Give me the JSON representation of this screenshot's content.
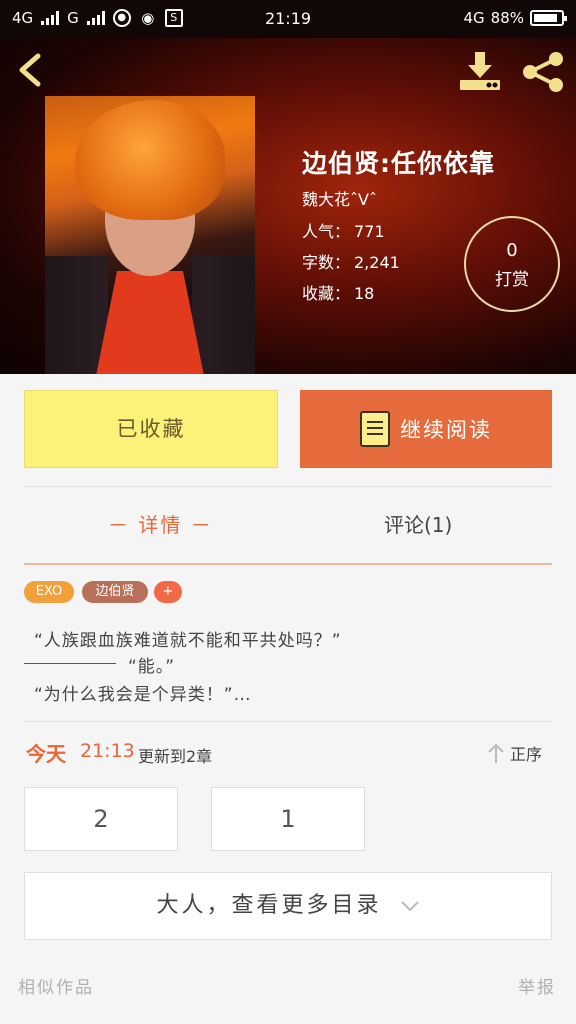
{
  "status_bar": {
    "net1": "4G",
    "net2": "G",
    "time": "21:19",
    "net3": "4G",
    "battery_percent": "88%",
    "battery_level": 0.88,
    "icons": [
      "signal-icon",
      "signal-icon",
      "camera-app-icon",
      "weibo-icon",
      "s-app-icon",
      "battery-icon"
    ]
  },
  "header": {
    "title": "边伯贤:任你依靠",
    "author": "魏大花ˆVˆ",
    "stats": [
      {
        "label": "人气：",
        "value": "771"
      },
      {
        "label": "字数：",
        "value": "2,241"
      },
      {
        "label": "收藏：",
        "value": "18"
      }
    ],
    "tip_count": "0",
    "tip_label": "打赏",
    "icons": {
      "back": "back-arrow-icon",
      "download": "download-icon",
      "share": "share-icon"
    }
  },
  "actions": {
    "collected_label": "已收藏",
    "read_label": "继续阅读"
  },
  "tabs": {
    "details": "－ 详情 －",
    "comments": "评论(1)"
  },
  "tags": [
    "EXO",
    "边伯贤",
    "+"
  ],
  "description": {
    "line1": "“人族跟血族难道就不能和平共处吗？”",
    "line2": "“能。”",
    "line3": "“为什么我会是个异类！”…"
  },
  "update": {
    "day": "今天",
    "time": "21:13",
    "text": "更新到2章",
    "sort_label": "正序"
  },
  "chapters": [
    "2",
    "1"
  ],
  "more_catalog": "大人，查看更多目录",
  "footer": {
    "similar": "相似作品",
    "report": "举报"
  },
  "colors": {
    "accent": "#e66b3c",
    "collected_bg": "#fcf27a",
    "tag_exo": "#f0a13c",
    "tag_name": "#b9705a",
    "tag_add": "#f06a48",
    "header_gold": "#e8d9a8"
  }
}
